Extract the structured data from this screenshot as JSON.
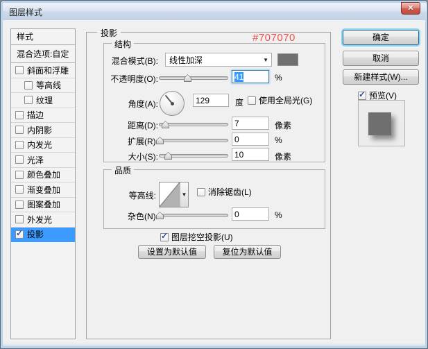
{
  "window": {
    "title": "图层样式"
  },
  "icons": {
    "close": "✕",
    "dropdown_arrow": "▼",
    "combo_arrow": "▼",
    "check": "✓"
  },
  "sidebar": {
    "header": "样式",
    "blending": "混合选项:自定",
    "items": [
      {
        "label": "斜面和浮雕",
        "checked": false,
        "selected": false
      },
      {
        "label": "等高线",
        "checked": false,
        "selected": false
      },
      {
        "label": "纹理",
        "checked": false,
        "selected": false
      },
      {
        "label": "描边",
        "checked": false,
        "selected": false
      },
      {
        "label": "内阴影",
        "checked": false,
        "selected": false
      },
      {
        "label": "内发光",
        "checked": false,
        "selected": false
      },
      {
        "label": "光泽",
        "checked": false,
        "selected": false
      },
      {
        "label": "颜色叠加",
        "checked": false,
        "selected": false
      },
      {
        "label": "渐变叠加",
        "checked": false,
        "selected": false
      },
      {
        "label": "图案叠加",
        "checked": false,
        "selected": false
      },
      {
        "label": "外发光",
        "checked": false,
        "selected": false
      },
      {
        "label": "投影",
        "checked": true,
        "selected": true
      }
    ]
  },
  "main": {
    "panel_title": "投影",
    "annotation": {
      "text": "#707070",
      "color": "#ef5350"
    },
    "structure": {
      "legend": "结构",
      "blend_mode": {
        "label": "混合模式(B):",
        "value": "线性加深",
        "swatch": "#707070"
      },
      "opacity": {
        "label": "不透明度(O):",
        "value": "41",
        "unit": "%",
        "percent": 41
      },
      "angle": {
        "label": "角度(A):",
        "value": "129",
        "unit": "度",
        "degrees": 129,
        "global_light_label": "使用全局光(G)",
        "global_light_checked": false
      },
      "distance": {
        "label": "距离(D):",
        "value": "7",
        "unit": "像素",
        "percent": 9
      },
      "spread": {
        "label": "扩展(R):",
        "value": "0",
        "unit": "%",
        "percent": 1
      },
      "size": {
        "label": "大小(S):",
        "value": "10",
        "unit": "像素",
        "percent": 13
      }
    },
    "quality": {
      "legend": "品质",
      "contour_label": "等高线:",
      "anti_alias": {
        "label": "消除锯齿(L)",
        "checked": false
      },
      "noise": {
        "label": "杂色(N):",
        "value": "0",
        "unit": "%",
        "percent": 1
      }
    },
    "knockout": {
      "label": "图层挖空投影(U)",
      "checked": true
    },
    "make_default": "设置为默认值",
    "reset_default": "复位为默认值"
  },
  "actions": {
    "ok": "确定",
    "cancel": "取消",
    "new_style": "新建样式(W)...",
    "preview": {
      "label": "预览(V)",
      "checked": true
    }
  },
  "colors": {
    "selection": "#3399ff",
    "selected_row": "#3d9bff",
    "shadow_color": "#707070"
  }
}
